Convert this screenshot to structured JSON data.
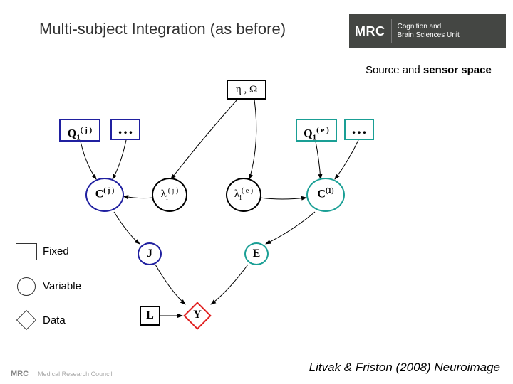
{
  "title": "Multi-subject Integration (as before)",
  "subtitle_prefix": "Source and ",
  "subtitle_bold1": "sensor",
  "subtitle_mid": " ",
  "subtitle_bold2": "space",
  "logo": {
    "mrc": "MRC",
    "line1": "Cognition and",
    "line2": "Brain Sciences Unit"
  },
  "nodes": {
    "eta_omega": "η , Ω",
    "Qj": "Q",
    "Qj_sub": "1",
    "Qj_sup": "( j )",
    "Qj_dots": "…",
    "Qe": "Q",
    "Qe_sub": "1",
    "Qe_sup": "( e )",
    "Qe_dots": "…",
    "Cj": "C",
    "Cj_sup": "( j )",
    "lambda_j": "λ",
    "lambda_j_sub": "i",
    "lambda_j_sup": "( j )",
    "lambda_e": "λ",
    "lambda_e_sub": "i",
    "lambda_e_sup": "( e )",
    "C1": "C",
    "C1_sup": "(1)",
    "J": "J",
    "E": "E",
    "L": "L",
    "Y": "Y"
  },
  "legend": {
    "fixed": "Fixed",
    "variable": "Variable",
    "data": "Data"
  },
  "citation": "Litvak & Friston (2008) Neuroimage",
  "footer": {
    "mrc": "MRC",
    "text": "Medical Research Council"
  },
  "diagram": {
    "type": "graphical-model",
    "legend": {
      "rectangle": "Fixed",
      "circle": "Variable",
      "diamond": "Data"
    },
    "nodes": [
      {
        "id": "eta_omega",
        "label": "η, Ω",
        "shape": "rect",
        "color": "black"
      },
      {
        "id": "Qj",
        "label": "Q₁^(j)",
        "shape": "rect",
        "color": "navy"
      },
      {
        "id": "Qj_more",
        "label": "…",
        "shape": "rect",
        "color": "navy"
      },
      {
        "id": "Qe",
        "label": "Q₁^(e)",
        "shape": "rect",
        "color": "teal"
      },
      {
        "id": "Qe_more",
        "label": "…",
        "shape": "rect",
        "color": "teal"
      },
      {
        "id": "Cj",
        "label": "C^(j)",
        "shape": "circle",
        "color": "navy"
      },
      {
        "id": "lambda_j",
        "label": "λᵢ^(j)",
        "shape": "circle",
        "color": "black"
      },
      {
        "id": "lambda_e",
        "label": "λᵢ^(e)",
        "shape": "circle",
        "color": "black"
      },
      {
        "id": "C1",
        "label": "C^(1)",
        "shape": "circle",
        "color": "teal"
      },
      {
        "id": "J",
        "label": "J",
        "shape": "circle",
        "color": "navy"
      },
      {
        "id": "E",
        "label": "E",
        "shape": "circle",
        "color": "teal"
      },
      {
        "id": "L",
        "label": "L",
        "shape": "rect",
        "color": "black"
      },
      {
        "id": "Y",
        "label": "Y",
        "shape": "diamond",
        "color": "red"
      }
    ],
    "edges": [
      [
        "eta_omega",
        "lambda_j"
      ],
      [
        "eta_omega",
        "lambda_e"
      ],
      [
        "Qj",
        "Cj"
      ],
      [
        "Qj_more",
        "Cj"
      ],
      [
        "Qe",
        "C1"
      ],
      [
        "Qe_more",
        "C1"
      ],
      [
        "lambda_j",
        "Cj"
      ],
      [
        "lambda_e",
        "C1"
      ],
      [
        "Cj",
        "J"
      ],
      [
        "C1",
        "E"
      ],
      [
        "J",
        "Y"
      ],
      [
        "E",
        "Y"
      ],
      [
        "L",
        "Y"
      ]
    ]
  }
}
